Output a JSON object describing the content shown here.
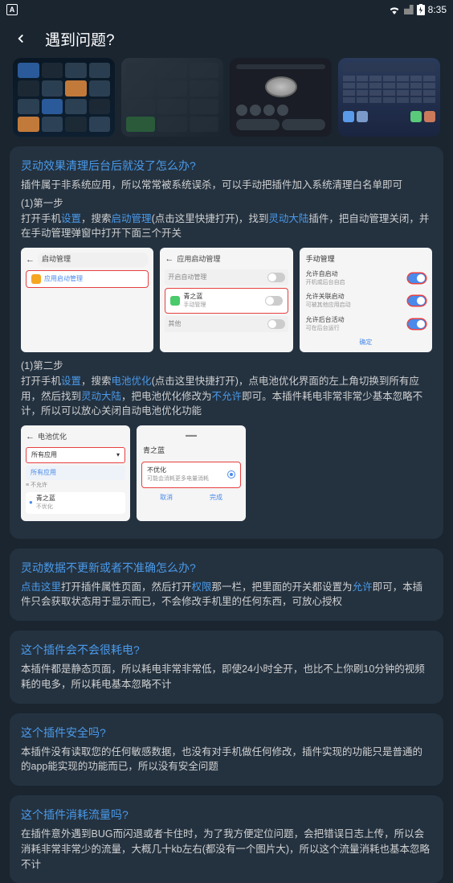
{
  "status": {
    "app_indicator": "A",
    "time": "8:35"
  },
  "header": {
    "title": "遇到问题?"
  },
  "sections": {
    "section1": {
      "title": "灵动效果清理后台后就没了怎么办?",
      "intro": "插件属于非系统应用，所以常常被系统误杀，可以手动把插件加入系统清理白名单即可",
      "step1_heading": "(1)第一步",
      "step1_pre": "打开手机",
      "step1_link1": "设置",
      "step1_mid1": "，搜索",
      "step1_link2": "启动管理",
      "step1_mid2": "(点击这里快捷打开)，找到",
      "step1_link3": "灵动大陆",
      "step1_post": "插件，把自动管理关闭，并在手动管理弹窗中打开下面三个开关",
      "step2_heading": "(1)第二步",
      "step2_pre": "打开手机",
      "step2_link1": "设置",
      "step2_mid1": "，搜索",
      "step2_link2": "电池优化",
      "step2_mid2": "(点击这里快捷打开)，点电池优化界面的左上角切换到所有应用，然后找到",
      "step2_link3": "灵动大陆",
      "step2_mid3": "，把电池优化修改为",
      "step2_link4": "不允许",
      "step2_post": "即可。本插件耗电非常非常少基本忽略不计，所以可以放心关闭自动电池优化功能"
    },
    "section2": {
      "title": "灵动数据不更新或者不准确怎么办?",
      "link1": "点击这里",
      "mid1": "打开插件属性页面，然后打开",
      "link2": "权限",
      "mid2": "那一栏，把里面的开关都设置为",
      "link3": "允许",
      "post": "即可，本插件只会获取状态用于显示而已，不会修改手机里的任何东西，可放心授权"
    },
    "section3": {
      "title": "这个插件会不会很耗电?",
      "text": "本插件都是静态页面，所以耗电非常非常低，即使24小时全开，也比不上你刷10分钟的视频耗的电多，所以耗电基本忽略不计"
    },
    "section4": {
      "title": "这个插件安全吗?",
      "text": "本插件没有读取您的任何敏感数据，也没有对手机做任何修改，插件实现的功能只是普通的的app能实现的功能而已，所以没有安全问题"
    },
    "section5": {
      "title": "这个插件消耗流量吗?",
      "text": "在插件意外遇到BUG而闪退或者卡住时，为了我方便定位问题，会把错误日志上传，所以会消耗非常非常少的流量，大概几十kb左右(都没有一个图片大)，所以这个流量消耗也基本忽略不计"
    }
  },
  "screenshots": {
    "ss1_search": "启动管理",
    "ss1_app": "应用启动管理",
    "ss2_header": "应用启动管理",
    "ss2_auto": "开启自动管理",
    "ss2_app": "青之蓝",
    "ss2_sub": "手动管理",
    "ss2_other": "其他",
    "ss3_header": "手动管理",
    "ss3_opt1": "允许自启动",
    "ss3_sub1": "开机或后台自启",
    "ss3_opt2": "允许关联启动",
    "ss3_sub2": "可被其他应用启动",
    "ss3_opt3": "允许后台活动",
    "ss3_sub3": "可在后台运行",
    "ss3_confirm": "确定",
    "ss4_header": "电池优化",
    "ss4_dropdown": "所有应用",
    "ss4_option": "所有应用",
    "ss4_item1": "不允许",
    "ss4_item2": "青之蓝",
    "ss4_sub": "不优化",
    "ss5_header": "青之蓝",
    "ss5_opt_title": "不优化",
    "ss5_opt_sub": "可能会消耗更多电量消耗",
    "ss5_cancel": "取消",
    "ss5_done": "完成"
  }
}
